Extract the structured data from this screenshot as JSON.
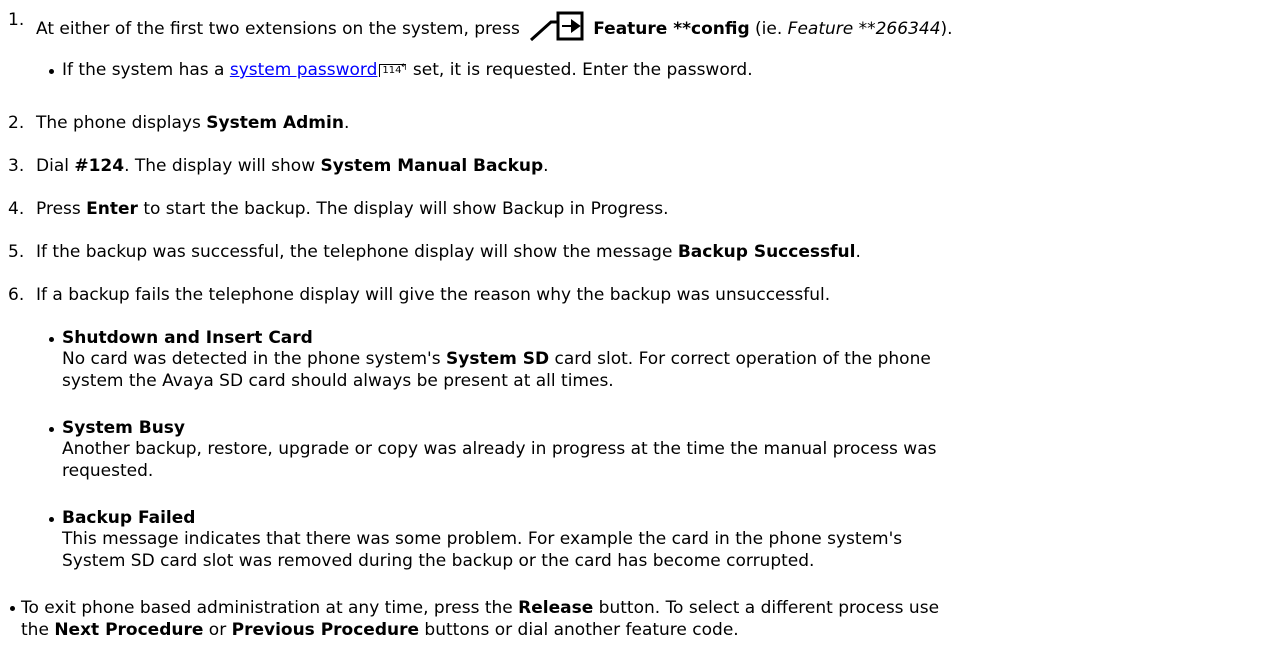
{
  "steps": [
    {
      "num": "1.",
      "pre": "At either of the first two extensions on the system, press ",
      "icon": "feature-icon",
      "bold": "Feature **config",
      "mid": " (ie. ",
      "italic": "Feature **266344",
      "post": ")."
    },
    {
      "num": "2.",
      "pre": "The phone displays ",
      "bold": "System Admin",
      "post": "."
    },
    {
      "num": "3.",
      "pre": "Dial ",
      "bold": "#124",
      "mid": ". The display will show ",
      "bold2": "System Manual Backup",
      "post": "."
    },
    {
      "num": "4.",
      "pre": "Press ",
      "bold": "Enter",
      "post": " to start the backup. The display will show Backup in Progress."
    },
    {
      "num": "5.",
      "pre": "If the backup was successful, the telephone display will show the message ",
      "bold": "Backup Successful",
      "post": "."
    },
    {
      "num": "6.",
      "pre": "If a backup fails the telephone display will give the reason why the backup was unsuccessful."
    }
  ],
  "password_note": {
    "pre": "If the system has a ",
    "link": "system password",
    "ref": "114",
    "post": " set, it is requested. Enter the password."
  },
  "messages": [
    {
      "head": "Shutdown and Insert Card",
      "l1a": "No card was detected in the phone system's ",
      "l1b": "System SD",
      "l1c": " card slot. For correct operation of the phone",
      "l2": "system the Avaya SD card should always be present at all times."
    },
    {
      "head": "System Busy",
      "l1": "Another backup, restore, upgrade or copy was already in progress at the time the manual process was",
      "l2": "requested."
    },
    {
      "head": "Backup Failed",
      "l1": "This message indicates that there was some problem. For example the card in the phone system's",
      "l2": "System SD card slot was removed during the backup or the card has become corrupted."
    }
  ],
  "exit_note": {
    "a": "To exit phone based administration at any time, press the ",
    "b": "Release",
    "c": " button. To select a different process use",
    "d": "the ",
    "e": "Next Procedure",
    "f": " or ",
    "g": "Previous Procedure",
    "h": " buttons or dial another feature code."
  }
}
